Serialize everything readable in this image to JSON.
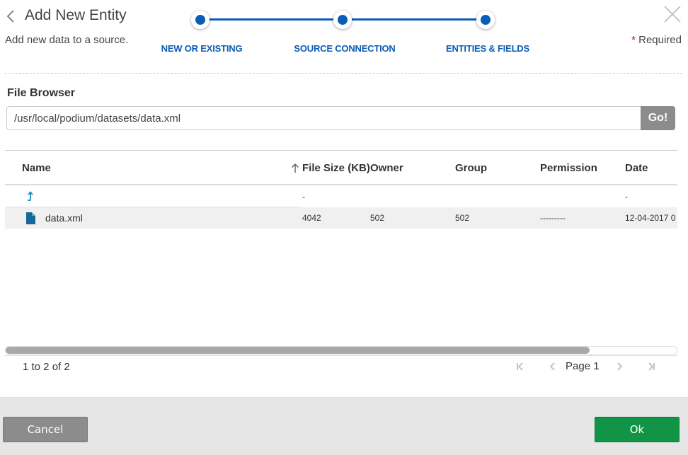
{
  "header": {
    "title": "Add New Entity",
    "subtitle": "Add new data to a source.",
    "required_star": "*",
    "required_label": "Required"
  },
  "stepper": {
    "color": "#0b5cb5",
    "steps": [
      {
        "label": "NEW OR EXISTING",
        "completed": true
      },
      {
        "label": "SOURCE CONNECTION",
        "completed": true
      },
      {
        "label": "ENTITIES & FIELDS",
        "completed": true
      }
    ]
  },
  "file_browser": {
    "label": "File Browser",
    "path_value": "/usr/local/podium/datasets/data.xml",
    "go_label": "Go!"
  },
  "table": {
    "columns": [
      "Name",
      "File Size (KB)",
      "Owner",
      "Group",
      "Permission",
      "Date"
    ],
    "sorted_column": "File Size (KB)",
    "sort_direction": "ascending",
    "rows": [
      {
        "type": "parent-directory",
        "icon": "level-up-icon",
        "name": "",
        "size": "-",
        "owner": "",
        "group": "",
        "permission": "",
        "date": "-"
      },
      {
        "type": "file",
        "icon": "file-icon",
        "name": "data.xml",
        "size": "4042",
        "owner": "502",
        "group": "502",
        "permission": "---------",
        "date": "12-04-2017 0"
      }
    ],
    "horizontal_scroll_visible_fraction": 0.87
  },
  "pagination": {
    "summary": "1 to 2 of 2",
    "page_label": "Page",
    "page_number": "1"
  },
  "footer": {
    "cancel_label": "Cancel",
    "ok_label": "Ok",
    "ok_color": "#119446"
  }
}
